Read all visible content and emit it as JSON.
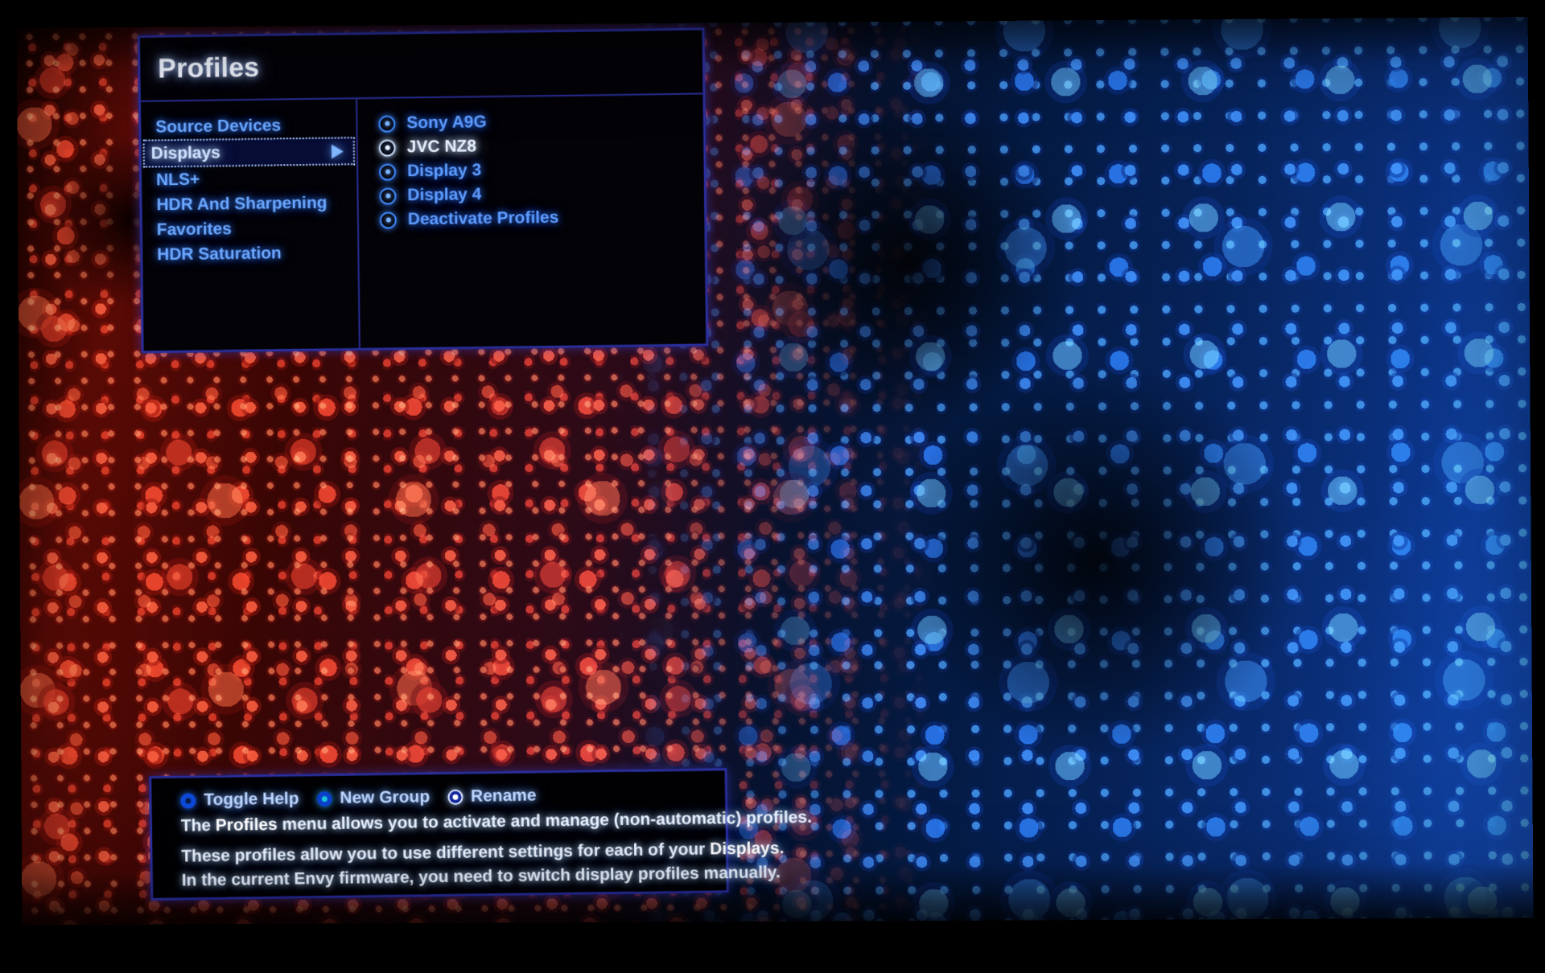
{
  "osd": {
    "title": "Profiles",
    "left_menu": [
      {
        "label": "Source Devices",
        "selected": false,
        "has_submenu": false
      },
      {
        "label": "Displays",
        "selected": true,
        "has_submenu": true
      },
      {
        "label": "NLS+",
        "selected": false,
        "has_submenu": false
      },
      {
        "label": "HDR And Sharpening",
        "selected": false,
        "has_submenu": false
      },
      {
        "label": "Favorites",
        "selected": false,
        "has_submenu": false
      },
      {
        "label": "HDR Saturation",
        "selected": false,
        "has_submenu": false
      }
    ],
    "right_options": [
      {
        "label": "Sony A9G",
        "active": false
      },
      {
        "label": "JVC NZ8",
        "active": true
      },
      {
        "label": "Display 3",
        "active": false
      },
      {
        "label": "Display 4",
        "active": false
      },
      {
        "label": "Deactivate Profiles",
        "active": false
      }
    ],
    "submenu_arrow_icon": "triangle-right-icon"
  },
  "help": {
    "buttons": [
      {
        "label": "Toggle Help",
        "icon": "radio-dot-blue-icon",
        "dot": "d-blue"
      },
      {
        "label": "New Group",
        "icon": "radio-dot-cyan-icon",
        "dot": "d-cyan"
      },
      {
        "label": "Rename",
        "icon": "radio-dot-white-icon",
        "dot": "d-white"
      }
    ],
    "lines": [
      {
        "pre": "The ",
        "bold": "Profiles",
        "post": " menu allows you to activate and manage (non-automatic) profiles."
      },
      {
        "pre": "These profiles allow you to use different settings for each of your ",
        "bold": "Displays",
        "post": "."
      },
      {
        "pre": "In the current Envy firmware, you need to switch display profiles manually.",
        "bold": "",
        "post": ""
      }
    ]
  },
  "colors": {
    "panel_border": "#2b2f9e",
    "panel_bg": "#030206",
    "menu_text": "#6ba8ff",
    "selected_text": "#cfe4ff",
    "selected_bg": "#060c34",
    "title_text": "#f2f6ff",
    "help_text": "#e9f2ff",
    "wallpaper_red": "#e8381f",
    "wallpaper_blue": "#1b5ad6"
  }
}
